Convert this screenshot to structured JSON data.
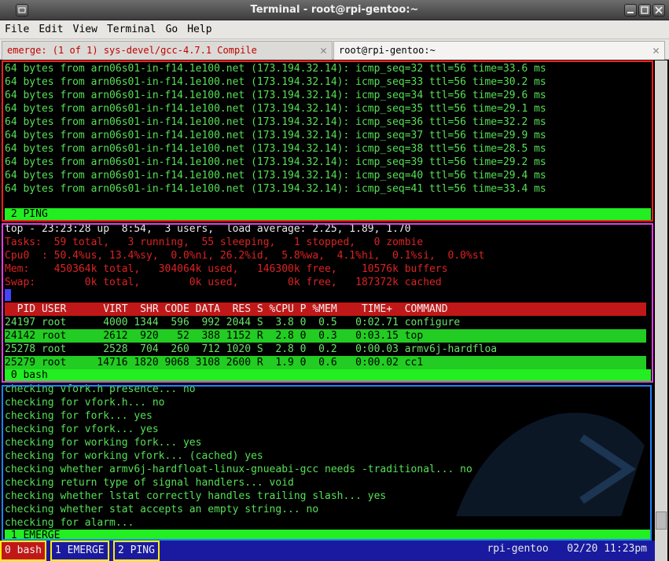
{
  "window": {
    "title": "Terminal - root@rpi-gentoo:~"
  },
  "menu": [
    "File",
    "Edit",
    "View",
    "Terminal",
    "Go",
    "Help"
  ],
  "tabs": [
    {
      "label": "emerge: (1 of 1) sys-devel/gcc-4.7.1 Compile"
    },
    {
      "label": "root@rpi-gentoo:~"
    }
  ],
  "ping": {
    "lines": [
      "64 bytes from arn06s01-in-f14.1e100.net (173.194.32.14): icmp_seq=32 ttl=56 time=33.6 ms",
      "64 bytes from arn06s01-in-f14.1e100.net (173.194.32.14): icmp_seq=33 ttl=56 time=30.2 ms",
      "64 bytes from arn06s01-in-f14.1e100.net (173.194.32.14): icmp_seq=34 ttl=56 time=29.6 ms",
      "64 bytes from arn06s01-in-f14.1e100.net (173.194.32.14): icmp_seq=35 ttl=56 time=29.1 ms",
      "64 bytes from arn06s01-in-f14.1e100.net (173.194.32.14): icmp_seq=36 ttl=56 time=32.2 ms",
      "64 bytes from arn06s01-in-f14.1e100.net (173.194.32.14): icmp_seq=37 ttl=56 time=29.9 ms",
      "64 bytes from arn06s01-in-f14.1e100.net (173.194.32.14): icmp_seq=38 ttl=56 time=28.5 ms",
      "64 bytes from arn06s01-in-f14.1e100.net (173.194.32.14): icmp_seq=39 ttl=56 time=29.2 ms",
      "64 bytes from arn06s01-in-f14.1e100.net (173.194.32.14): icmp_seq=40 ttl=56 time=29.4 ms",
      "64 bytes from arn06s01-in-f14.1e100.net (173.194.32.14): icmp_seq=41 ttl=56 time=33.4 ms"
    ],
    "status": " 2 PING"
  },
  "top": {
    "header": "top - 23:23:28 up  8:54,  3 users,  load average: 2.25, 1.89, 1.70",
    "tasks": "Tasks:  59 total,   3 running,  55 sleeping,   1 stopped,   0 zombie",
    "cpu": "Cpu0  : 50.4%us, 13.4%sy,  0.0%ni, 26.2%id,  5.8%wa,  4.1%hi,  0.1%si,  0.0%st",
    "mem": "Mem:    450364k total,   304064k used,   146300k free,    10576k buffers",
    "swap": "Swap:        0k total,        0k used,        0k free,   187372k cached",
    "table_header": "  PID USER      VIRT  SHR CODE DATA  RES S %CPU P %MEM    TIME+  COMMAND",
    "rows": [
      "24197 root      4000 1344  596  992 2044 S  3.8 0  0.5   0:02.71 configure",
      "24142 root      2612  920   52  388 1152 R  2.8 0  0.3   0:03.15 top",
      "25278 root      2528  704  260  712 1020 S  2.8 0  0.2   0:00.03 armv6j-hardfloa",
      "25279 root     14716 1820 9068 3108 2600 R  1.9 0  0.6   0:00.02 cc1"
    ],
    "status": " 0 bash"
  },
  "emerge": {
    "lines": [
      "checking vfork.h presence... no",
      "checking for vfork.h... no",
      "checking for fork... yes",
      "checking for vfork... yes",
      "checking for working fork... yes",
      "checking for working vfork... (cached) yes",
      "checking whether armv6j-hardfloat-linux-gnueabi-gcc needs -traditional... no",
      "checking return type of signal handlers... void",
      "checking whether lstat correctly handles trailing slash... yes",
      "checking whether stat accepts an empty string... no",
      "checking for alarm..."
    ],
    "status": " 1 EMERGE"
  },
  "bottom": {
    "windows": [
      "0 bash",
      "1 EMERGE",
      "2 PING"
    ],
    "host": "rpi-gentoo",
    "datetime": "02/20 11:23pm"
  },
  "colors": {
    "ping_border": "#ff2020",
    "top_border": "#e040e0",
    "emerge_border": "#2080ff",
    "status_green": "#22ee22"
  }
}
